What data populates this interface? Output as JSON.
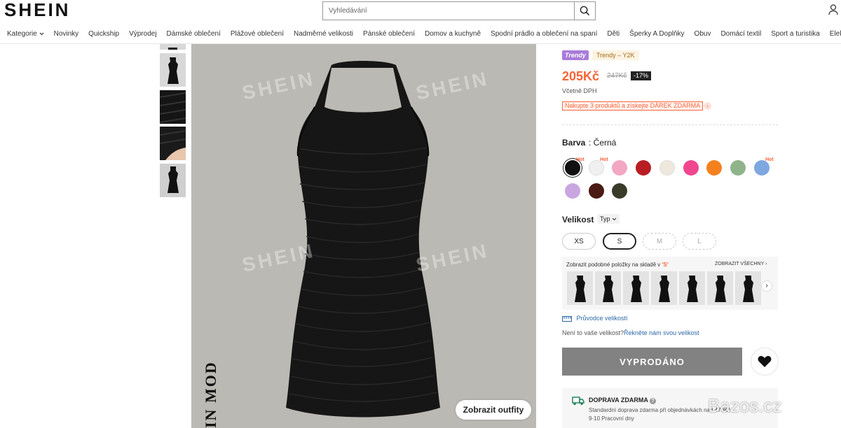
{
  "brand": {
    "logo": "SHEIN"
  },
  "search": {
    "placeholder": "Vyhledávání"
  },
  "nav": [
    "Kategorie",
    "Novinky",
    "Quickship",
    "Výprodej",
    "Dámské oblečení",
    "Plážové oblečení",
    "Nadměrné velikosti",
    "Pánské oblečení",
    "Domov a kuchyně",
    "Spodní prádlo a oblečení na spaní",
    "Děti",
    "Šperky A Doplňky",
    "Obuv",
    "Domácí textil",
    "Sport a turistika",
    "Elek"
  ],
  "gallery": {
    "watermark": "SHEIN",
    "vertical_text": "IN MOD",
    "outfit_button": "Zobrazit outfity"
  },
  "product": {
    "badge_trendy": "Trendy",
    "badge_style": "Trendy – Y2K",
    "price": "205Kč",
    "old_price": "247Kč",
    "discount": "-17%",
    "vat_note": "Včetně DPH",
    "promo": "Nakupte 3 produktů a získejte DÁREK ZDARMA",
    "color_label": "Barva",
    "color_value": ": Černá",
    "hot_label": "Hot",
    "swatches": [
      "#111111",
      "#f0f0f0",
      "#f2a7c3",
      "#b81d24",
      "#eee8dc",
      "#f0468f",
      "#f5801e",
      "#8fb38a",
      "#7fa7e0",
      "#c9a6e0",
      "#4a1a14",
      "#3b3b2a"
    ],
    "size_label": "Velikost",
    "size_type": "Typ",
    "sizes": [
      "XS",
      "S",
      "M",
      "L"
    ],
    "similar_title": "Zobrazit podobné položky na skladě v ",
    "similar_size": "'S'",
    "similar_all": "ZOBRAZIT VŠECHNY",
    "size_guide": "Průvodce velikostí",
    "ask_prefix": "Není to vaše velikost?",
    "ask_link": "Řekněte nám svou velikost",
    "soldout": "VYPRODÁNO",
    "shipping_title": "DOPRAVA ZDARMA",
    "shipping_line1": "Standardní doprava zdarma při objednávkách nad 470Kč",
    "shipping_line2": "9-10 Pracovní dny"
  },
  "overlay_watermark": "Bazos.cz"
}
